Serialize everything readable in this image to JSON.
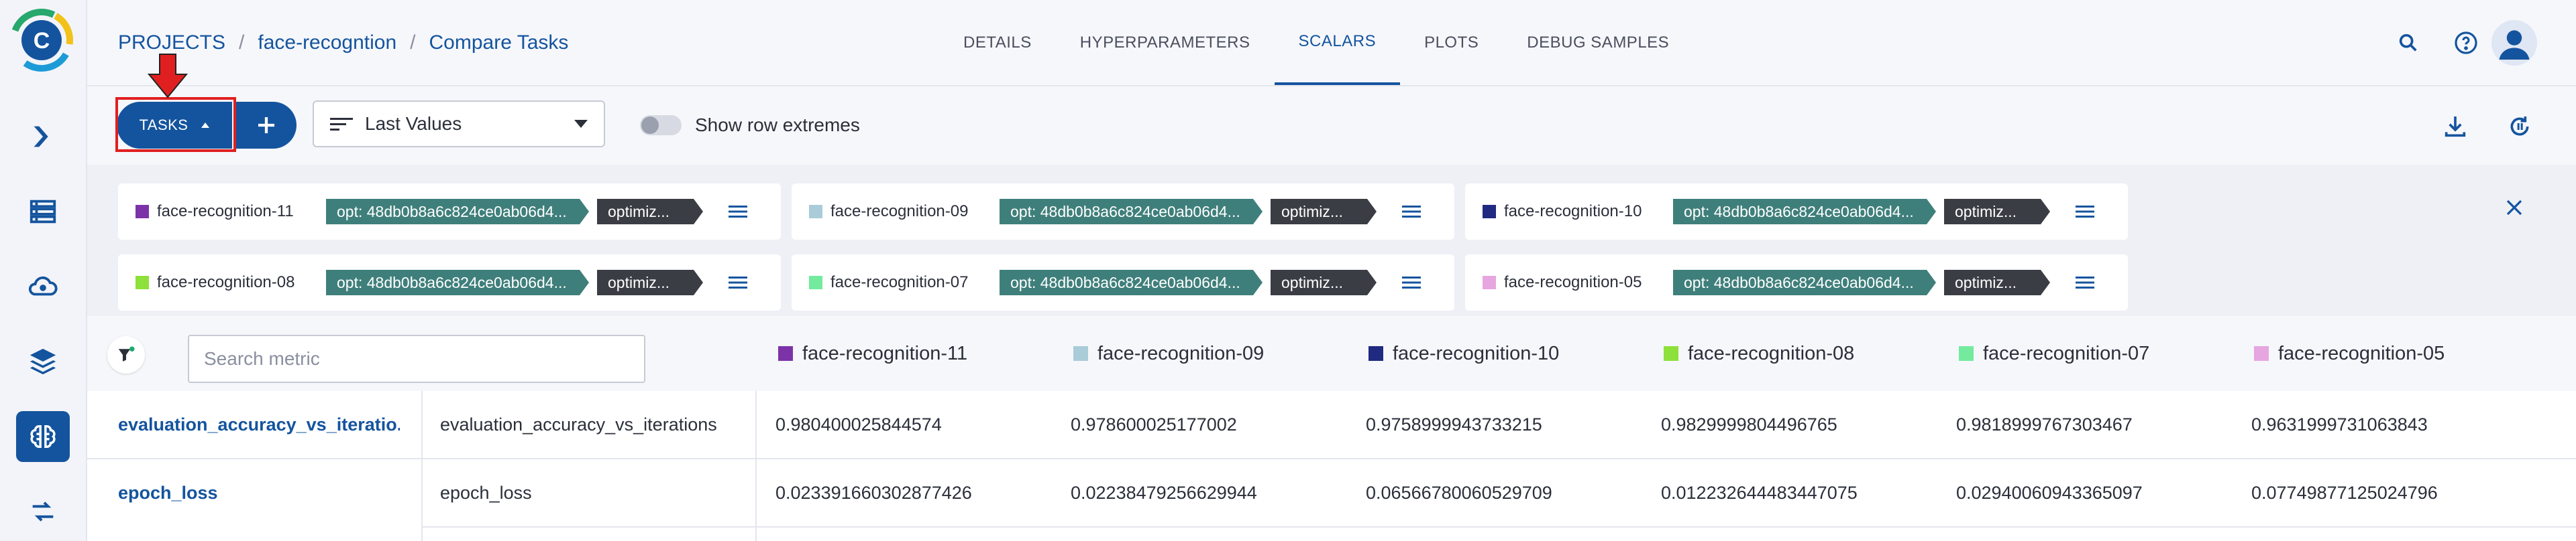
{
  "breadcrumb": {
    "root": "PROJECTS",
    "separator": "/",
    "project": "face-recogntion",
    "current": "Compare Tasks"
  },
  "tabs": [
    {
      "label": "DETAILS",
      "active": false
    },
    {
      "label": "HYPERPARAMETERS",
      "active": false
    },
    {
      "label": "SCALARS",
      "active": true
    },
    {
      "label": "PLOTS",
      "active": false
    },
    {
      "label": "DEBUG SAMPLES",
      "active": false
    }
  ],
  "sidebar": {
    "items": [
      {
        "icon": "pipelines-icon"
      },
      {
        "icon": "datasets-icon"
      },
      {
        "icon": "orchestration-icon"
      },
      {
        "icon": "model-layers-icon"
      },
      {
        "icon": "brain-icon",
        "active": true
      },
      {
        "icon": "reports-icon"
      }
    ]
  },
  "toolbar": {
    "tasks_label": "TASKS",
    "value_select": "Last Values",
    "toggle_label": "Show row extremes",
    "toggle_on": false
  },
  "experiments": [
    {
      "name": "face-recognition-11",
      "color": "#7d33a8",
      "tag_opt": "opt: 48db0b8a6c824ce0ab06d4...",
      "tag_optim": "optimiz..."
    },
    {
      "name": "face-recognition-09",
      "color": "#a9ccd8",
      "tag_opt": "opt: 48db0b8a6c824ce0ab06d4...",
      "tag_optim": "optimiz..."
    },
    {
      "name": "face-recognition-10",
      "color": "#1f2a80",
      "tag_opt": "opt: 48db0b8a6c824ce0ab06d4...",
      "tag_optim": "optimiz..."
    },
    {
      "name": "face-recognition-08",
      "color": "#8ee03a",
      "tag_opt": "opt: 48db0b8a6c824ce0ab06d4...",
      "tag_optim": "optimiz..."
    },
    {
      "name": "face-recognition-07",
      "color": "#73ea9e",
      "tag_opt": "opt: 48db0b8a6c824ce0ab06d4...",
      "tag_optim": "optimiz..."
    },
    {
      "name": "face-recognition-05",
      "color": "#e6a6e0",
      "tag_opt": "opt: 48db0b8a6c824ce0ab06d4...",
      "tag_optim": "optimiz..."
    }
  ],
  "table": {
    "search_placeholder": "Search metric",
    "rows": [
      {
        "metric": "evaluation_accuracy_vs_iteratio...",
        "variant": "evaluation_accuracy_vs_iterations",
        "values": [
          "0.980400025844574",
          "0.978600025177002",
          "0.9758999943733215",
          "0.9829999804496765",
          "0.9818999767303467",
          "0.9631999731063843"
        ]
      },
      {
        "metric": "epoch_loss",
        "variant": "epoch_loss",
        "values": [
          "0.023391660302877426",
          "0.02238479256629944",
          "0.06566780060529709",
          "0.012232644483447075",
          "0.02940060943365097",
          "0.07749877125024796"
        ]
      }
    ]
  },
  "colors": {
    "primary": "#14549e",
    "tag_teal": "#3f7f7b",
    "tag_dark": "#3a3d44",
    "highlight": "#e02020"
  }
}
